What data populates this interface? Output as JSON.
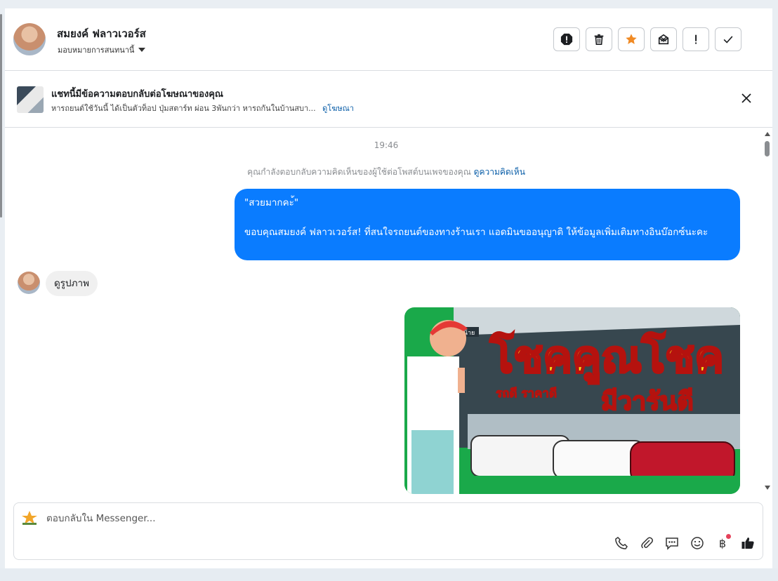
{
  "header": {
    "contact_name": "สมยงค์ ฟลาวเวอร์ส",
    "assign_label": "มอบหมายการสนทนานี้",
    "actions": [
      "spam-icon",
      "trash-icon",
      "star-icon",
      "mark-unread-icon",
      "important-icon",
      "done-icon"
    ]
  },
  "ad_banner": {
    "title": "แชทนี้มีข้อความตอบกลับต่อโฆษณาของคุณ",
    "description": "หารถยนต์ใช้วันนี้ ได้เป็นตัวท็อป ปุ่มสตาร์ท ผ่อน 3พันกว่า หารถกันในบ้านสบา...",
    "link": "ดูโฆษณา"
  },
  "chat": {
    "timestamp": "19:46",
    "system_note": "คุณกำลังตอบกลับความคิดเห็นของผู้ใช้ต่อโพสต์บนเพจของคุณ",
    "system_link": "ดูความคิดเห็น",
    "outgoing_quote": "\"สวยมากคะ้\"",
    "outgoing_body": "ขอบคุณสมยงค์ ฟลาวเวอร์ส! ที่สนใจรถยนต์ของทางร้านเรา แอดมินขออนุญาติ ให้ข้อมูลเพิ่มเติมทางอินบ๊อกซ์นะคะ",
    "incoming_text": "ดูรูปภาพ",
    "image": {
      "headline": "โชคคูณโชค",
      "sub_left": "รถดี ราคาดี",
      "sub_right": "มีวารันตี",
      "sign": "อ่างหน้าย",
      "colors": {
        "headline": "#f7e61b",
        "accent": "#d8231f",
        "bg": "#1aa94a"
      }
    }
  },
  "composer": {
    "placeholder": "ตอบกลับใน Messenger...",
    "tools": [
      "phone-icon",
      "attach-icon",
      "saved-replies-icon",
      "emoji-icon",
      "baht-icon",
      "like-icon"
    ],
    "baht_symbol": "฿"
  },
  "colors": {
    "accent": "#0a7cff",
    "link": "#0a5ea8",
    "star": "#f08a24"
  }
}
